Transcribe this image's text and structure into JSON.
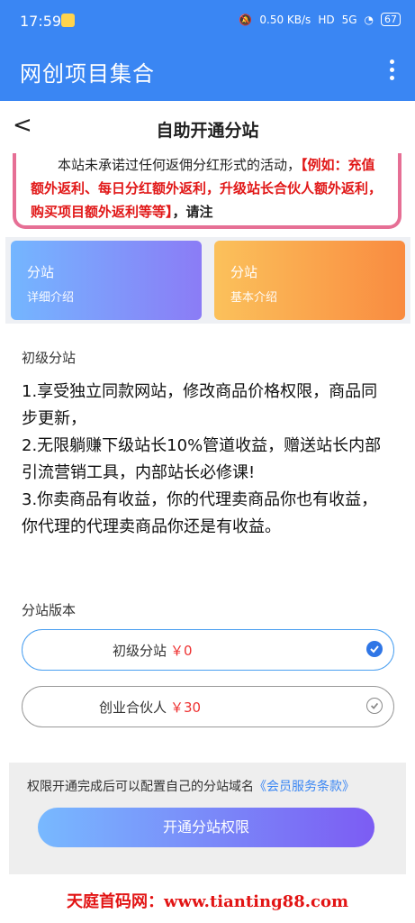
{
  "statusbar": {
    "time": "17:59",
    "network": "0.50 KB/s",
    "hd": "HD",
    "signal": "5G",
    "battery": "67"
  },
  "appbar": {
    "title": "网创项目集合"
  },
  "page": {
    "title": "自助开通分站"
  },
  "notice": {
    "line1": "本站未承诺过任何返佣分红形式的活动，",
    "red_part": "【例如：充值额外返利、每日分红额外返利，升级站长合伙人额外返利，购买项目额外返利等等】",
    "tail": "，请注"
  },
  "cards": [
    {
      "title": "分站",
      "subtitle": "详细介绍",
      "color": "#74b6ff"
    },
    {
      "title": "分站",
      "subtitle": "基本介绍",
      "color": "#f98b40"
    }
  ],
  "level_label": "初级分站",
  "benefits": [
    "1.享受独立同款网站，修改商品价格权限，商品同步更新，",
    "2.无限躺赚下级站长10%管道收益，赠送站长内部引流营销工具，内部站长必修课!",
    "3.你卖商品有收益，你的代理卖商品你也有收益，你代理的代理卖商品你还是有收益。"
  ],
  "version_label": "分站版本",
  "options": [
    {
      "name": "初级分站",
      "price": "￥0",
      "selected": true
    },
    {
      "name": "创业合伙人",
      "price": "￥30",
      "selected": false
    }
  ],
  "terms": {
    "text": "权限开通完成后可以配置自己的分站域名",
    "link": "《会员服务条款》"
  },
  "submit_label": "开通分站权限",
  "watermark": "天庭首码网：www.tianting88.com",
  "colors": {
    "primary": "#3a86f3",
    "accent_red": "#e11818"
  }
}
